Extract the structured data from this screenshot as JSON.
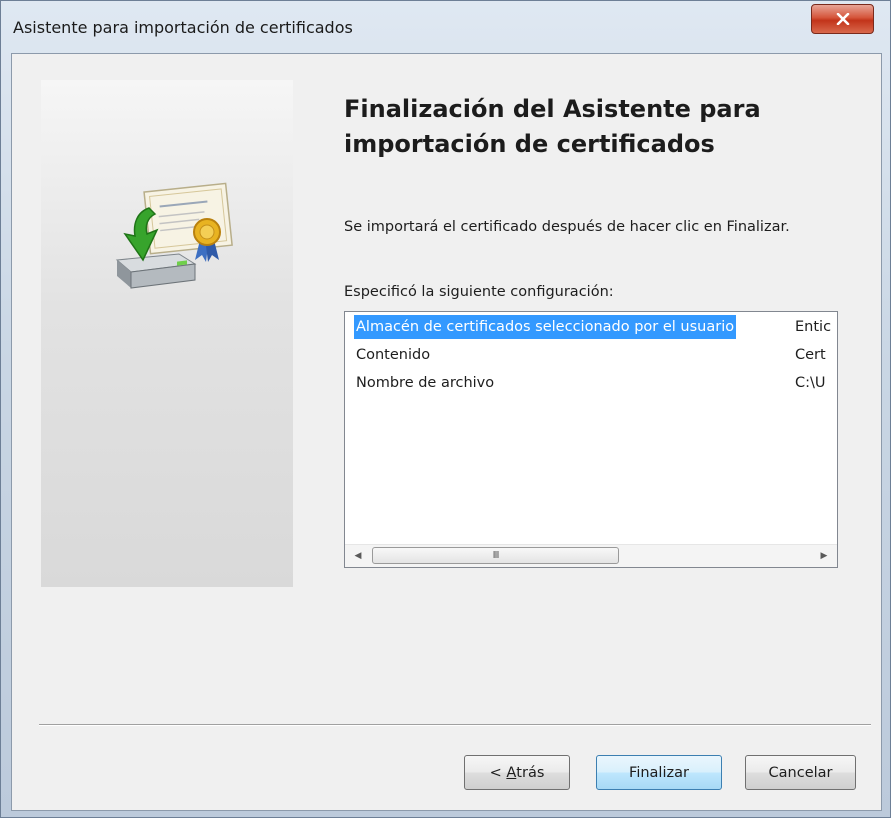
{
  "window": {
    "title": "Asistente para importación de certificados"
  },
  "wizard": {
    "heading": "Finalización del Asistente para importación de certificados",
    "description": "Se importará el certificado después de hacer clic en Finalizar.",
    "spec_label": "Especificó la siguiente configuración:"
  },
  "settings_list": {
    "rows": [
      {
        "name": "Almacén de certificados seleccionado por el usuario",
        "value": "Entic",
        "selected": true
      },
      {
        "name": "Contenido",
        "value": "Cert",
        "selected": false
      },
      {
        "name": "Nombre de archivo",
        "value": "C:\\U",
        "selected": false
      }
    ],
    "scroll_grip": "III"
  },
  "buttons": {
    "back_accel": "A",
    "back_rest": "trás",
    "back_prefix": "< ",
    "finish": "Finalizar",
    "cancel": "Cancelar"
  },
  "icons": {
    "close": "close-icon",
    "wizard_graphic": "certificate-import-icon",
    "scroll_left": "scroll-left-arrow-icon",
    "scroll_right": "scroll-right-arrow-icon"
  },
  "colors": {
    "selection": "#3399ff",
    "close_button": "#c2341a",
    "primary_button_border": "#3c7fb1"
  }
}
